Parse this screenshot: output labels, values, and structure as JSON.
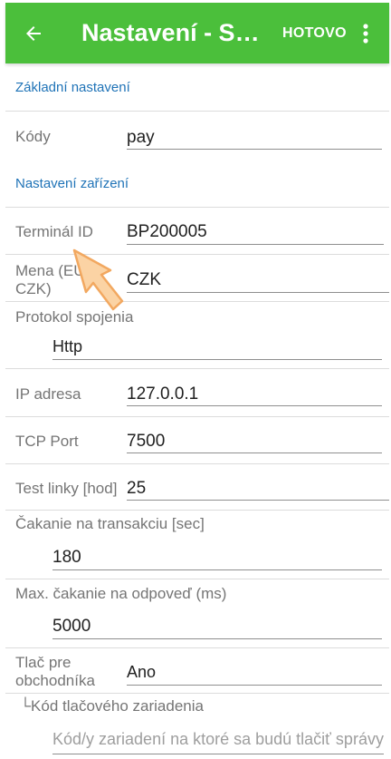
{
  "appbar": {
    "title": "Nastavení - Správ...",
    "done_label": "HOTOVO",
    "back_icon": "arrow-back-icon",
    "menu_icon": "more-vert-icon",
    "color": "#4bbf3b"
  },
  "sections": {
    "basic": "Základní nastavení",
    "device": "Nastavení zařízení"
  },
  "fields": {
    "codes": {
      "label": "Kódy",
      "value": "pay"
    },
    "terminal_id": {
      "label": "Terminál ID",
      "value": "BP200005"
    },
    "currency": {
      "label_line1": "Mena (EU",
      "label_line2": "CZK)",
      "value": "CZK"
    },
    "protocol": {
      "label": "Protokol spojenia",
      "value": "Http"
    },
    "ip": {
      "label": "IP adresa",
      "value": "127.0.0.1"
    },
    "tcp_port": {
      "label": "TCP Port",
      "value": "7500"
    },
    "test_line": {
      "label": "Test linky [hod]",
      "value": "25"
    },
    "tx_wait": {
      "label": "Čakanie na transakciu [sec]",
      "value": "180"
    },
    "max_wait": {
      "label": "Max. čakanie na odpoveď (ms)",
      "value": "5000"
    },
    "merchant_print": {
      "label_line1": "Tlač pre",
      "label_line2": "obchodníka",
      "value": "Ano"
    },
    "printer_code": {
      "label": "└Kód tlačového zariadenia",
      "placeholder": "Kód/y zariadení na ktoré sa budú tlačiť správy"
    }
  },
  "accent_color": "#1f73b7"
}
